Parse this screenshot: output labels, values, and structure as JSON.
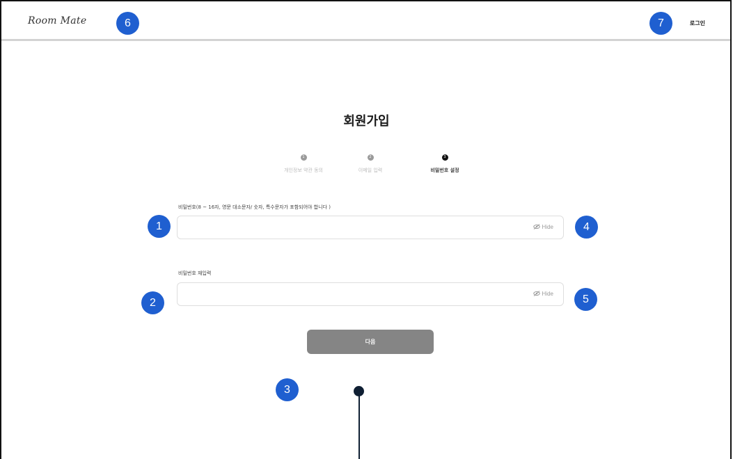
{
  "header": {
    "logo": "Room Mate",
    "login_label": "로그인"
  },
  "page": {
    "title": "회원가입"
  },
  "steps": [
    {
      "number": "1",
      "label": "개인정보 약관 동의",
      "active": false
    },
    {
      "number": "2",
      "label": "이메일 입력",
      "active": false
    },
    {
      "number": "3",
      "label": "비밀번호 설정",
      "active": true
    }
  ],
  "form": {
    "password_label": "비밀번호(8 ~ 16자, 영문 대소문자/ 숫자, 특수문자가 포함되어야 합니다 )",
    "password_value": "",
    "confirm_label": "비밀번호 재입력",
    "confirm_value": "",
    "hide_label": "Hide",
    "next_label": "다음"
  },
  "annotations": {
    "m1": "1",
    "m2": "2",
    "m3": "3",
    "m4": "4",
    "m5": "5",
    "m6": "6",
    "m7": "7"
  },
  "colors": {
    "marker": "#1f5fd0",
    "button": "#858585",
    "active_step": "#111111",
    "inactive_step": "#9a9a9a"
  },
  "icons": {
    "hide_toggle": "eye-slash-icon"
  }
}
